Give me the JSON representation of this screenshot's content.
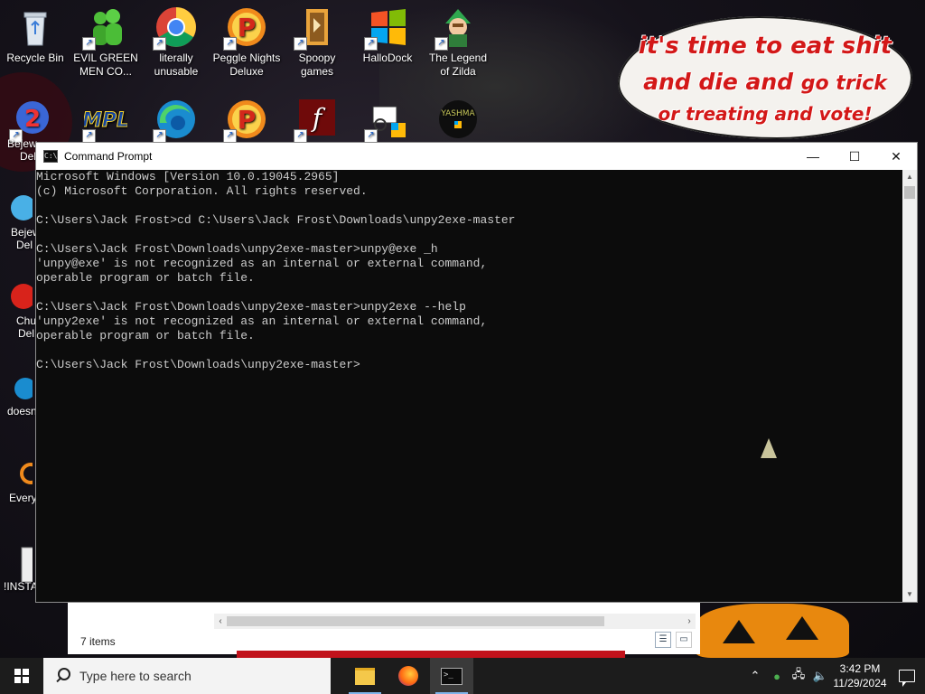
{
  "desktop": {
    "icons_top": [
      {
        "label": "Recycle Bin",
        "icon": "recycle-bin-icon"
      },
      {
        "label": "EVIL GREEN MEN CO...",
        "icon": "green-men-icon"
      },
      {
        "label": "literally unusable",
        "icon": "chrome-icon"
      },
      {
        "label": "Peggle Nights Deluxe",
        "icon": "peggle-icon"
      },
      {
        "label": "Spoopy games",
        "icon": "folder-icon"
      },
      {
        "label": "HalloDock",
        "icon": "windows-logo-icon"
      },
      {
        "label": "The Legend of Zilda",
        "icon": "link-character-icon"
      }
    ],
    "icons_row2": [
      "bejeweled-icon",
      "mpl-icon",
      "edge-icon",
      "peggle-icon",
      "flash-icon",
      "network-icon",
      "yashma-icon"
    ],
    "left_partial": [
      {
        "label": "Bejew",
        "label2": "Del"
      },
      {
        "label": "Bejew",
        "label2": "Del"
      },
      {
        "label": "Chu",
        "label2": "Del"
      },
      {
        "label": "doesn",
        "label2": ""
      },
      {
        "label": "Every",
        "label2": ""
      },
      {
        "label": "!INSTA",
        "label2": ""
      }
    ],
    "bubble": {
      "line1": "it's time to eat shit",
      "line2a": "and die and",
      "line2b": "go trick",
      "line3": "or treating and vote!"
    }
  },
  "cmd": {
    "title": "Command Prompt",
    "lines": [
      "Microsoft Windows [Version 10.0.19045.2965]",
      "(c) Microsoft Corporation. All rights reserved.",
      "",
      "C:\\Users\\Jack Frost>cd C:\\Users\\Jack Frost\\Downloads\\unpy2exe-master",
      "",
      "C:\\Users\\Jack Frost\\Downloads\\unpy2exe-master>unpy@exe _h",
      "'unpy@exe' is not recognized as an internal or external command,",
      "operable program or batch file.",
      "",
      "C:\\Users\\Jack Frost\\Downloads\\unpy2exe-master>unpy2exe --help",
      "'unpy2exe' is not recognized as an internal or external command,",
      "operable program or batch file.",
      "",
      "C:\\Users\\Jack Frost\\Downloads\\unpy2exe-master>"
    ],
    "minimize": "—",
    "maximize": "☐",
    "close": "✕"
  },
  "explorer": {
    "status": "7 items"
  },
  "taskbar": {
    "search_placeholder": "Type here to search",
    "time": "3:42 PM",
    "date": "11/29/2024"
  }
}
